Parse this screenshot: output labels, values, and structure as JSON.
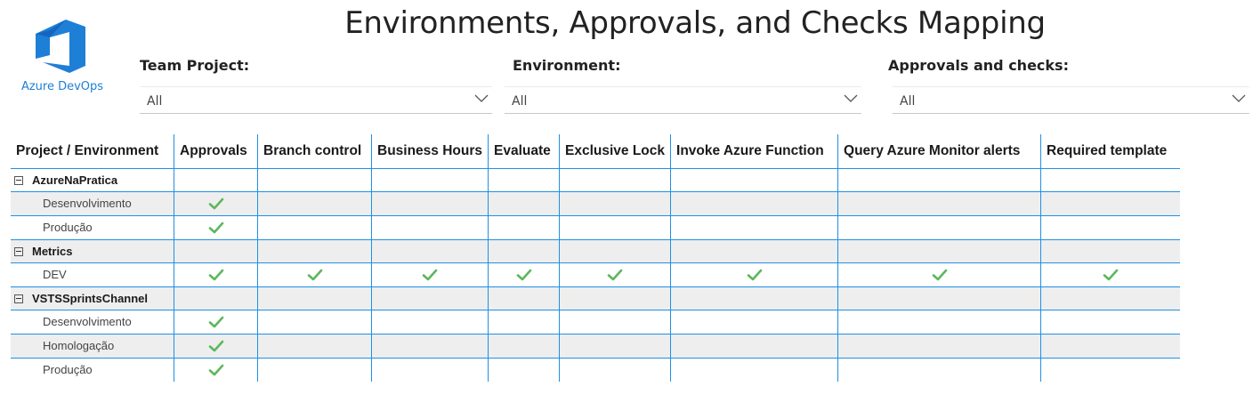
{
  "title": "Environments, Approvals, and Checks Mapping",
  "logo": {
    "text": "Azure DevOps",
    "color": "#1e7fd6"
  },
  "filters": [
    {
      "label": "Team Project:",
      "value": "All"
    },
    {
      "label": "Environment:",
      "value": "All"
    },
    {
      "label": "Approvals and checks:",
      "value": "All"
    }
  ],
  "table": {
    "columns": [
      "Project / Environment",
      "Approvals",
      "Branch control",
      "Business Hours",
      "Evaluate",
      "Exclusive Lock",
      "Invoke Azure Function",
      "Query Azure Monitor alerts",
      "Required template"
    ],
    "groups": [
      {
        "name": "AzureNaPratica",
        "rows": [
          {
            "name": "Desenvolvimento",
            "checks": [
              true,
              false,
              false,
              false,
              false,
              false,
              false,
              false
            ]
          },
          {
            "name": "Produção",
            "checks": [
              true,
              false,
              false,
              false,
              false,
              false,
              false,
              false
            ]
          }
        ]
      },
      {
        "name": "Metrics",
        "rows": [
          {
            "name": "DEV",
            "checks": [
              true,
              true,
              true,
              true,
              true,
              true,
              true,
              true
            ]
          }
        ]
      },
      {
        "name": "VSTSSprintsChannel",
        "rows": [
          {
            "name": "Desenvolvimento",
            "checks": [
              true,
              false,
              false,
              false,
              false,
              false,
              false,
              false
            ]
          },
          {
            "name": "Homologação",
            "checks": [
              true,
              false,
              false,
              false,
              false,
              false,
              false,
              false
            ]
          },
          {
            "name": "Produção",
            "checks": [
              true,
              false,
              false,
              false,
              false,
              false,
              false,
              false
            ]
          }
        ]
      }
    ]
  },
  "colors": {
    "grid": "#1e90e6",
    "check": "#5cb85c",
    "shade": "#eeeeee"
  },
  "icons": {
    "check": "checkmark-icon",
    "expander": "collapse-minus-icon",
    "dropdown": "chevron-down-icon"
  }
}
